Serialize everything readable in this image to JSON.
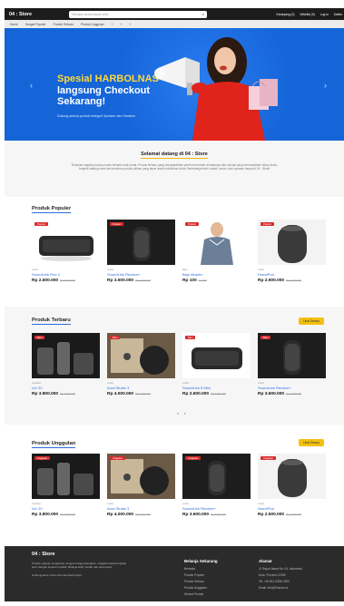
{
  "topbar": {
    "brand": "04 : Store",
    "search_placeholder": "Temukan produk Apple setia...",
    "nav": [
      "Keranjang (0)",
      "Wishlist (0)",
      "Log In",
      "Daftar"
    ]
  },
  "catbar": {
    "items": [
      "Home",
      "Sangat Populer",
      "Produk Terbaru",
      "Produk Unggulan",
      "+",
      "+",
      "+"
    ]
  },
  "hero": {
    "title_highlight": "Spesial HARBOLNAS",
    "title_rest": "langsung Checkout Sekarang!",
    "subtitle": "Dukung semua produk ketegori Speaker dan Headset"
  },
  "welcome": {
    "title": "Selamat datang di 04 : Store",
    "body": "Temukan segala produk-produk terbaik untuk Anda. Produk terbaru yang menghadirkan performa terbaik di kelasnya dan inovasi yang memudahkan hidup Anda. Jelajahi katalog kami dan temukan produk pilihan yang tepat untuk kebutuhan Anda. Berbelanja lebih mudah, aman, dan nyaman hanya di 04 : Store!"
  },
  "sections": [
    {
      "title": "Produk Populer",
      "see_all": "",
      "items": [
        {
          "badge": "Populer",
          "cat": "Audio",
          "name": "SoundLink Flex II",
          "price": "Rp 2.600.000",
          "old": "Rp 3.000.000"
        },
        {
          "badge": "Populer",
          "cat": "Audio",
          "name": "SoundLink Revolve+",
          "price": "Rp 3.600.000",
          "old": "Rp 4.000.000"
        },
        {
          "badge": "Populer",
          "cat": "Baju",
          "name": "Baju Muslim",
          "price": "Rp 100",
          "old": "Rp 200"
        },
        {
          "badge": "Populer",
          "cat": "Audio",
          "name": "HomePod",
          "price": "Rp 2.500.000",
          "old": "Rp 3.000.000"
        }
      ]
    },
    {
      "title": "Produk Terbaru",
      "see_all": "Lihat Semua",
      "items": [
        {
          "badge": "Baru",
          "cat": "Speaker",
          "name": "Lbr 2X",
          "price": "Rp 3.800.000",
          "old": "Rp 4.000.000"
        },
        {
          "badge": "Baru",
          "cat": "Audio",
          "name": "Aura Studio 3",
          "price": "Rp 4.000.000",
          "old": "Rp 5.000.000"
        },
        {
          "badge": "Baru",
          "cat": "Audio",
          "name": "SoundLink II Mini",
          "price": "Rp 2.600.000",
          "old": "Rp 3.000.000"
        },
        {
          "badge": "Baru",
          "cat": "Audio",
          "name": "SoundLink Revolve+",
          "price": "Rp 3.600.000",
          "old": "Rp 4.000.000"
        }
      ]
    },
    {
      "title": "Produk Unggulan",
      "see_all": "Lihat Semua",
      "items": [
        {
          "badge": "Unggulan",
          "cat": "Speaker",
          "name": "Lbr 2X",
          "price": "Rp 3.800.000",
          "old": "Rp 4.000.000"
        },
        {
          "badge": "Unggulan",
          "cat": "Audio",
          "name": "Aura Studio 3",
          "price": "Rp 4.000.000",
          "old": "Rp 5.000.000"
        },
        {
          "badge": "Unggulan",
          "cat": "Audio",
          "name": "SoundLink Revolve+",
          "price": "Rp 3.600.000",
          "old": "Rp 4.000.000"
        },
        {
          "badge": "Unggulan",
          "cat": "Audio",
          "name": "HomePod",
          "price": "Rp 2.500.000",
          "old": "Rp 3.000.000"
        }
      ]
    }
  ],
  "footer": {
    "brand": "04 : Store",
    "desc": "Produk original, bergaransi, dengan harga terjangkau. Jelajahi koleksi lengkap kami dengan layanan terbaik. Belanja lebih mudah dan terpercaya.",
    "desc2": "Hubungi kami untuk informasi lebih lanjut.",
    "col1_title": "Belanja Sekarang",
    "col1_items": [
      "Beranda",
      "Produk Populer",
      "Produk Terbaru",
      "Produk Unggulan",
      "Semua Produk"
    ],
    "col2_title": "Alamat",
    "col2_items": [
      "Jl. Raya Utama No. 04, Indonesia",
      "Kota, Provinsi 12345",
      "Tel: +62 812-3456-7890",
      "Email: info@04store.id"
    ]
  },
  "colors": {
    "nav": "#1c1c1c",
    "hero": "#1565d8",
    "accent": "#f2c012",
    "link": "#2d6cdf",
    "badge": "#d82b2b"
  }
}
